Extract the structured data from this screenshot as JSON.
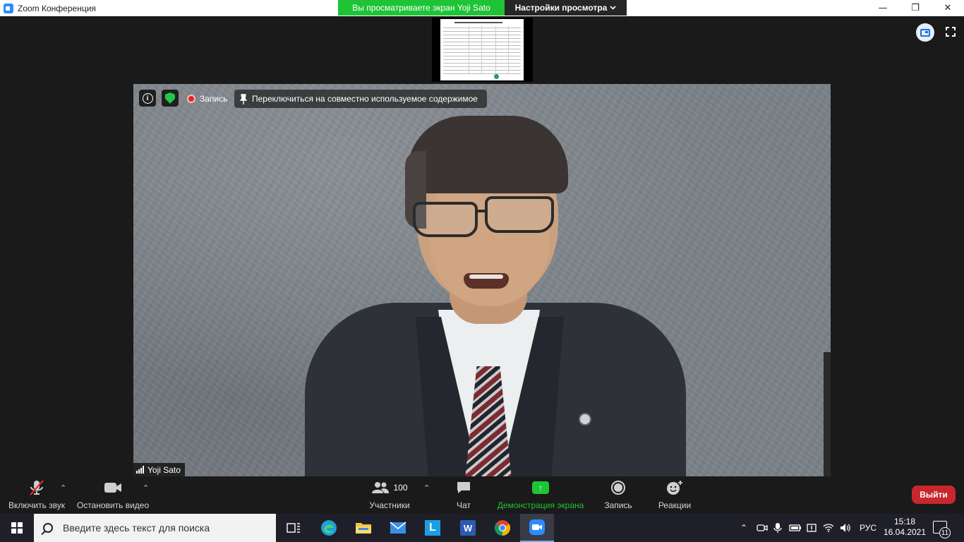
{
  "window": {
    "title": "Zoom Конференция",
    "minimize": "—",
    "restore": "❐",
    "close": "✕"
  },
  "banner": {
    "viewing_text": "Вы просматриваете экран Yoji Sato",
    "view_settings_label": "Настройки просмотра",
    "view_settings_icon": "chevron-down-icon"
  },
  "video": {
    "recording_label": "Запись",
    "switch_label": "Переключиться на совместно используемое содержимое",
    "participant_name": "Yoji Sato"
  },
  "toolbar": {
    "unmute_label": "Включить звук",
    "stop_video_label": "Остановить видео",
    "participants_label": "Участники",
    "participants_count": "100",
    "chat_label": "Чат",
    "share_label": "Демонстрация экрана",
    "record_label": "Запись",
    "reactions_label": "Реакции",
    "leave_label": "Выйти",
    "colors": {
      "share": "#1ec436",
      "leave": "#c8272d"
    }
  },
  "taskbar": {
    "search_placeholder": "Введите здесь текст для поиска",
    "language": "РУС",
    "time": "15:18",
    "date": "16.04.2021",
    "notification_count": "11"
  }
}
